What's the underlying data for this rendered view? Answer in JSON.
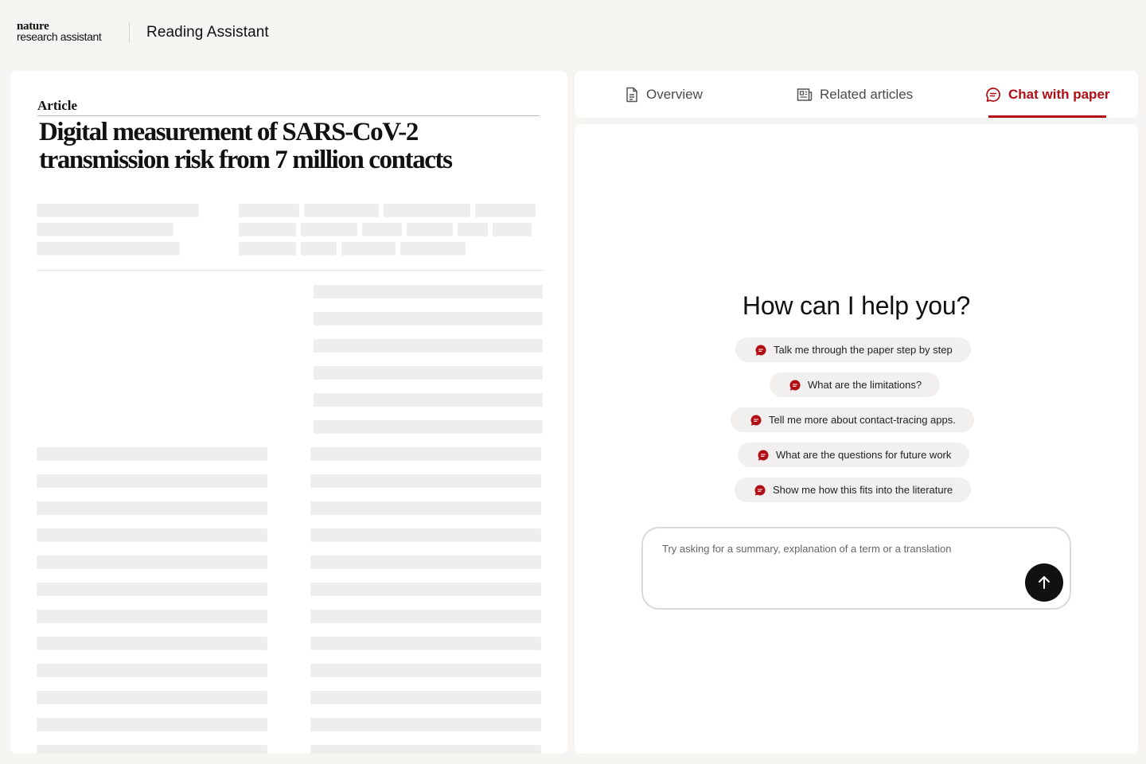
{
  "header": {
    "logo_line1": "nature",
    "logo_line2": "research assistant",
    "title": "Reading Assistant"
  },
  "paper": {
    "label": "Article",
    "title": "Digital measurement of SARS-CoV-2 transmission risk from 7 million contacts"
  },
  "tabs": [
    {
      "label": "Overview",
      "icon": "document-icon",
      "active": false
    },
    {
      "label": "Related articles",
      "icon": "newspaper-icon",
      "active": false
    },
    {
      "label": "Chat with paper",
      "icon": "chat-icon",
      "active": true
    }
  ],
  "chat": {
    "heading": "How can I help you?",
    "suggestions": [
      "Talk me through the paper step by step",
      "What are the limitations?",
      "Tell me more about contact-tracing apps.",
      "What are the questions for future work",
      "Show me how this fits into the literature"
    ],
    "input_placeholder": "Try asking for a summary, explanation of a term or a translation",
    "send_icon": "arrow-up-icon"
  },
  "colors": {
    "accent": "#b00d15",
    "background": "#f6f5f1",
    "skeleton": "#eeeeee"
  }
}
